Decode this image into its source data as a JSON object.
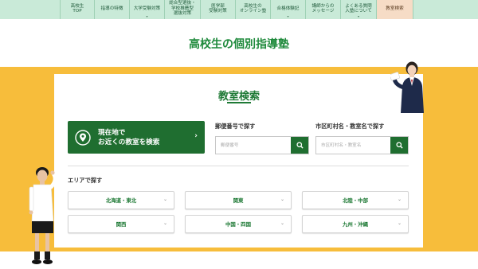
{
  "nav": {
    "items": [
      {
        "label": "高校生\nTOP",
        "dropdown": false,
        "active": false
      },
      {
        "label": "指導の特徴",
        "dropdown": false,
        "active": false
      },
      {
        "label": "大学受験対策",
        "dropdown": true,
        "active": false
      },
      {
        "label": "総合型選抜・\n学校推薦型\n選抜対策",
        "dropdown": false,
        "active": false
      },
      {
        "label": "医学部\n受験対策",
        "dropdown": false,
        "active": false
      },
      {
        "label": "高校生の\nオンライン塾",
        "dropdown": false,
        "active": false
      },
      {
        "label": "合格体験記",
        "dropdown": true,
        "active": false
      },
      {
        "label": "講師からの\nメッセージ",
        "dropdown": false,
        "active": false
      },
      {
        "label": "よくある質問\n入塾について",
        "dropdown": true,
        "active": false
      },
      {
        "label": "教室検索",
        "dropdown": false,
        "active": true
      }
    ]
  },
  "page_title": "高校生の個別指導塾",
  "search_card": {
    "title": "教室検索",
    "geo_button_label": "現在地で\nお近くの教室を検索",
    "postal": {
      "label": "郵便番号で探す",
      "placeholder": "郵便番号"
    },
    "city": {
      "label": "市区町村名・教室名で探す",
      "placeholder": "市区町村名・教室名"
    },
    "area_label": "エリアで探す",
    "areas": [
      "北海道・東北",
      "関東",
      "北陸・中部",
      "関西",
      "中国・四国",
      "九州・沖縄"
    ]
  },
  "colors": {
    "accent_green": "#1f6e30",
    "title_green": "#1f8a3c",
    "nav_bg": "#c9ead8",
    "nav_active_bg": "#f6dcc6",
    "band_yellow": "#f7bd3b"
  },
  "icons": {
    "geo": "location-pin-icon",
    "search": "search-icon",
    "dropdown": "chevron-down-icon",
    "arrow": "chevron-right-icon"
  }
}
